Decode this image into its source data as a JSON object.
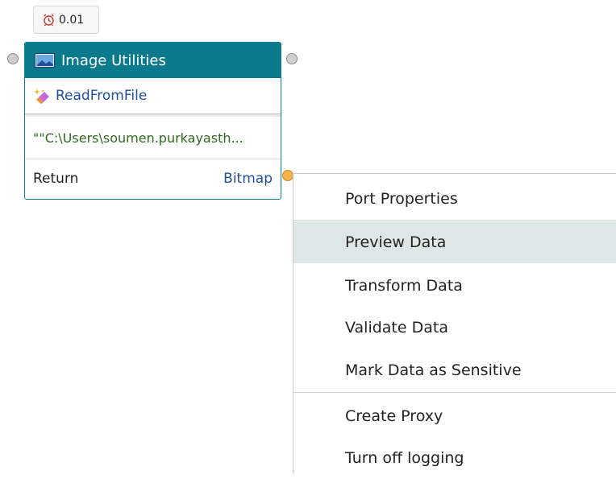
{
  "timer": {
    "value": "0.01",
    "icon": "alarm-clock-icon"
  },
  "node": {
    "title": "Image Utilities",
    "title_icon": "image-icon",
    "method": "ReadFromFile",
    "method_icon": "magic-eraser-icon",
    "argument": "\"\"C:\\Users\\soumen.purkayasth...",
    "return_label": "Return",
    "return_type": "Bitmap",
    "header_color": "#0b7a8d"
  },
  "context_menu": {
    "items": [
      {
        "label": "Port Properties"
      },
      {
        "label": "Preview Data",
        "highlighted": true
      },
      {
        "label": "Transform Data"
      },
      {
        "label": "Validate Data"
      },
      {
        "label": "Mark Data as Sensitive"
      },
      {
        "label": "Create Proxy"
      },
      {
        "label": "Turn off logging"
      }
    ],
    "highlight_color": "#dde8e6"
  }
}
